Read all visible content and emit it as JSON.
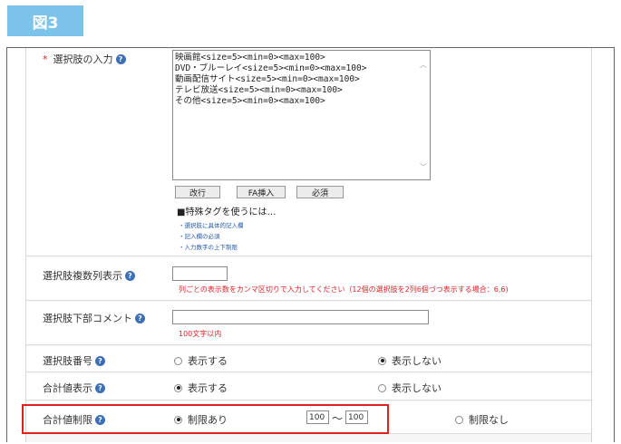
{
  "figure_label": "図3",
  "choices": {
    "label": "選択肢の入力",
    "required_mark": "*",
    "textarea_lines": "映画館<size=5><min=0><max=100>\nDVD・ブルーレイ<size=5><min=0><max=100>\n動画配信サイト<size=5><min=0><max=100>\nテレビ放送<size=5><min=0><max=100>\nその他<size=5><min=0><max=100>",
    "buttons": {
      "newline": "改行",
      "fa_insert": "FA挿入",
      "required": "必須"
    },
    "special_tags_heading": "■特殊タグを使うには…",
    "special_tags_links": [
      "選択肢に具体的記入欄",
      "記入欄の必須",
      "入力数字の上下制限"
    ]
  },
  "columns": {
    "label": "選択肢複数列表示",
    "value": "",
    "note": "列ごとの表示数をカンマ区切りで入力してください（12個の選択肢を2列6個づつ表示する場合：6,6)"
  },
  "comment": {
    "label": "選択肢下部コメント",
    "value": "",
    "note": "100文字以内"
  },
  "numbering": {
    "label": "選択肢番号",
    "options": [
      "表示する",
      "表示しない"
    ],
    "selected": "表示しない"
  },
  "total_display": {
    "label": "合計値表示",
    "options": [
      "表示する",
      "表示しない"
    ],
    "selected": "表示する"
  },
  "total_limit": {
    "label": "合計値制限",
    "options": [
      "制限あり",
      "制限なし"
    ],
    "selected": "制限あり",
    "min": "100",
    "max": "100",
    "tilde": "〜"
  },
  "help_glyph": "?",
  "colors": {
    "accent_label": "#7cc3ea",
    "required": "#d9232b",
    "highlight": "#e02020",
    "help": "#3d6fb6"
  }
}
